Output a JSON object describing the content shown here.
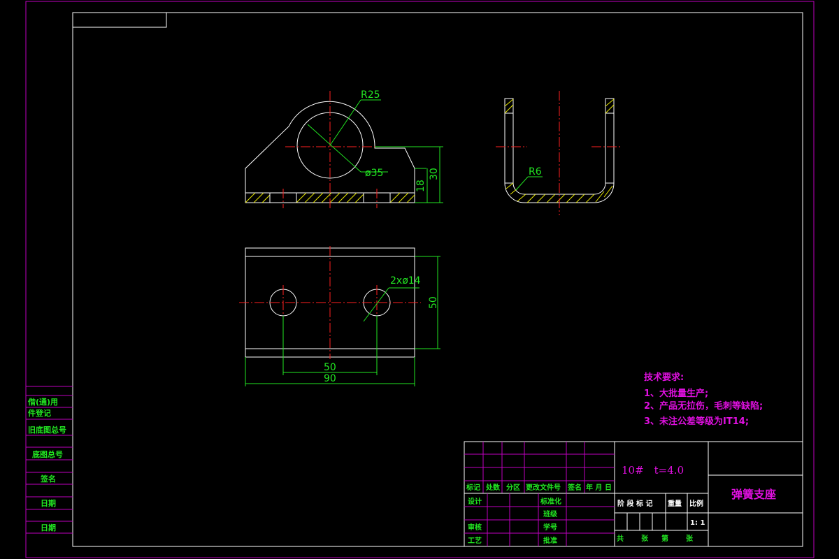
{
  "dimensions": {
    "front": {
      "r25": "R25",
      "d35": "ø35",
      "h18": "18",
      "h30": "30"
    },
    "side": {
      "r6": "R6"
    },
    "top": {
      "holes": "2xø14",
      "h50": "50",
      "w50": "50",
      "w90": "90"
    }
  },
  "tech_requirements": {
    "heading": "技术要求:",
    "items": [
      "1、大批量生产;",
      "2、产品无拉伤，毛刺等缺陷;",
      "3、未注公差等级为IT14;"
    ]
  },
  "left_margin": {
    "labels": [
      "借(通)用",
      "件登记",
      "旧底图总号",
      "底图总号",
      "签名",
      "日期",
      "日期"
    ]
  },
  "title_block": {
    "material": "10#　t=4.0",
    "part_name": "弹簧支座",
    "rev_header": [
      "标记",
      "处数",
      "分区",
      "更改文件号",
      "签名",
      "年 月 日"
    ],
    "roles_left": [
      "设计",
      "审核",
      "工艺"
    ],
    "roles_right": [
      "标准化",
      "班级",
      "学号",
      "批准"
    ],
    "stage_header": [
      "阶 段 标 记",
      "重量",
      "比例"
    ],
    "scale": "1: 1",
    "sheets": [
      "共",
      "张",
      "第",
      "张"
    ]
  },
  "colors": {
    "geometry": "#ffffff",
    "centerline": "#ff2020",
    "dimension": "#22e622",
    "frame": "#c000c0",
    "hatch": "#e8e800"
  }
}
